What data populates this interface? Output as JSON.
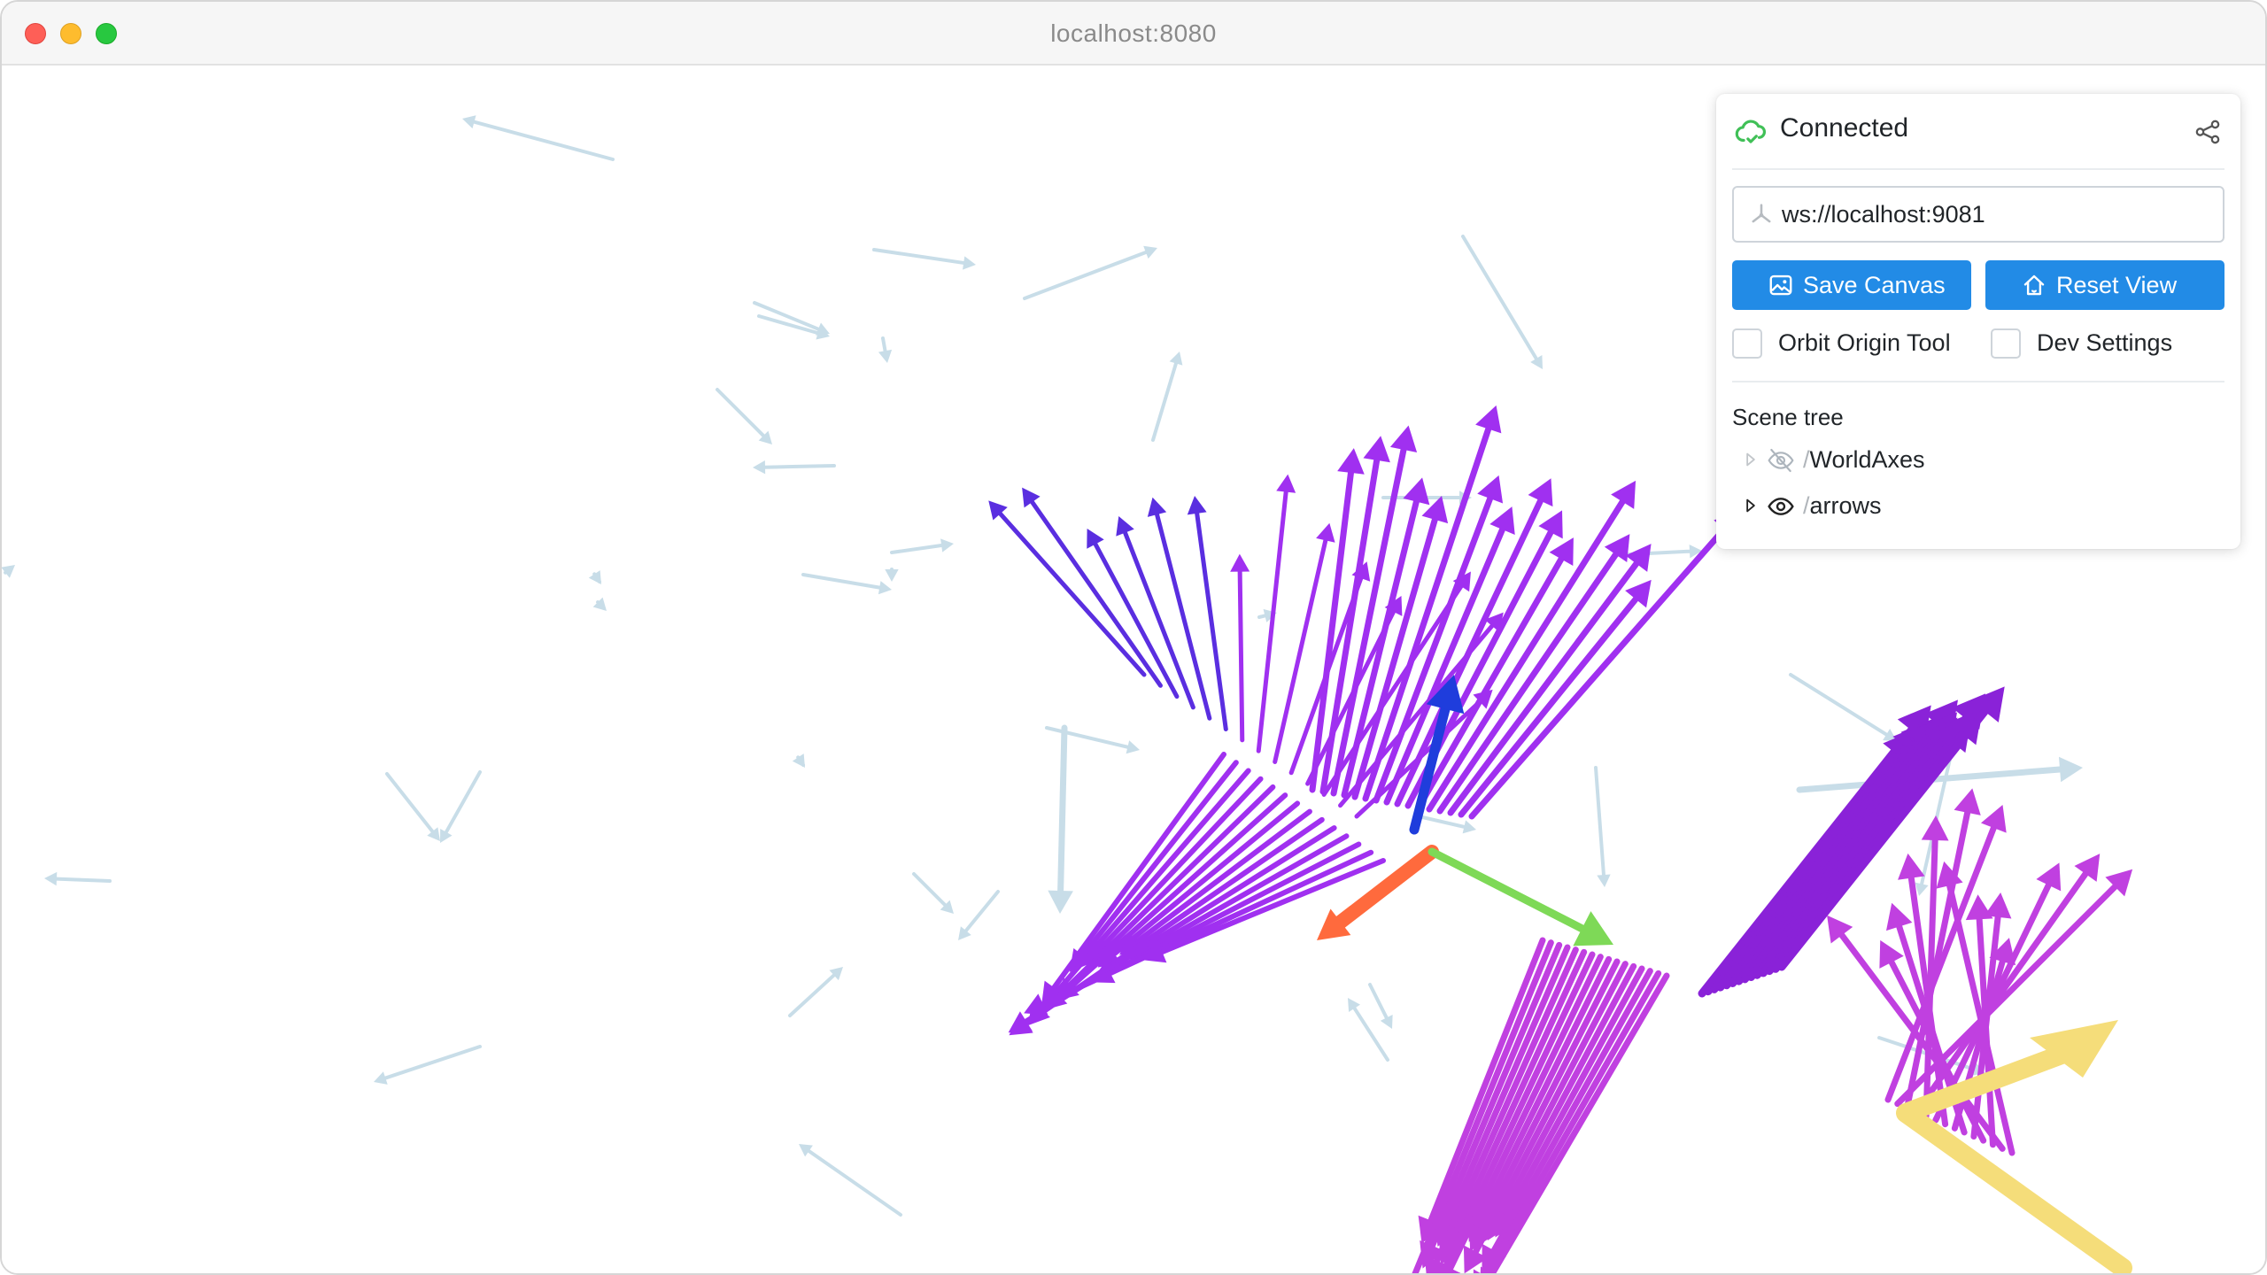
{
  "window": {
    "title": "localhost:8080"
  },
  "panel": {
    "status": "Connected",
    "server_url": "ws://localhost:9081",
    "buttons": {
      "save_canvas": "Save Canvas",
      "reset_view": "Reset View"
    },
    "checkboxes": {
      "orbit_origin_tool": {
        "label": "Orbit Origin Tool",
        "checked": false
      },
      "dev_settings": {
        "label": "Dev Settings",
        "checked": false
      }
    },
    "scene_tree": {
      "title": "Scene tree",
      "items": [
        {
          "slash": "/",
          "name": "WorldAxes",
          "visible": false,
          "icon": "eye-off-icon"
        },
        {
          "slash": "/",
          "name": "arrows",
          "visible": true,
          "icon": "eye-icon"
        }
      ]
    }
  },
  "colors": {
    "accent": "#228be6",
    "connected": "#40c057",
    "arrow_purple": "#a030f0",
    "arrow_magenta": "#c040e0",
    "arrow_light": "#c8dde8",
    "axis_x": "#ff6a3d",
    "axis_y": "#7ed957",
    "axis_z": "#1f3ddc",
    "highlight_yellow": "#f5dd7a"
  }
}
